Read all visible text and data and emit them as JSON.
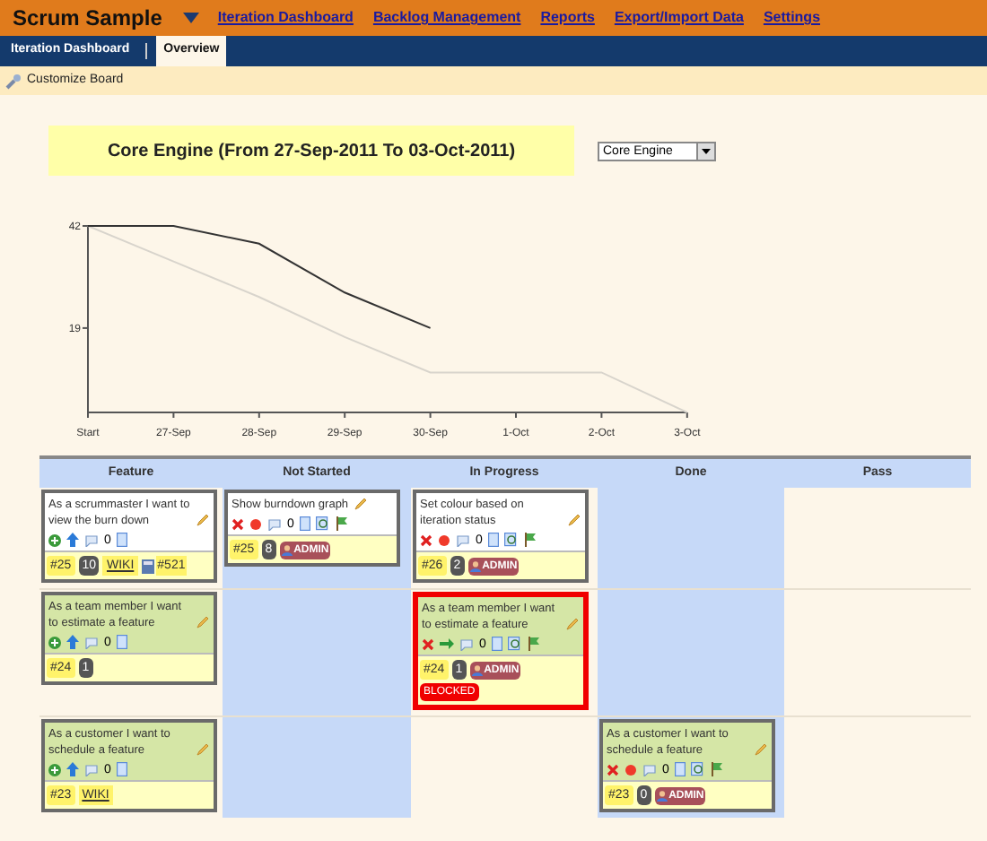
{
  "header": {
    "title": "Scrum Sample",
    "nav": [
      "Iteration Dashboard",
      "Backlog Management",
      "Reports",
      "Export/Import Data",
      "Settings"
    ]
  },
  "subnav": {
    "tabs": [
      {
        "label": "Iteration Dashboard",
        "selected": false
      },
      {
        "label": "Overview",
        "selected": true
      }
    ]
  },
  "toolbar": {
    "action": "Customize Board"
  },
  "iteration": {
    "title": "Core Engine (From 27-Sep-2011 To 03-Oct-2011)",
    "select_value": "Core Engine"
  },
  "burndown": {
    "chart_data": {
      "type": "line",
      "categories": [
        "Start",
        "27-Sep",
        "28-Sep",
        "29-Sep",
        "30-Sep",
        "1-Oct",
        "2-Oct",
        "3-Oct"
      ],
      "yticks": [
        19,
        42
      ],
      "ylim": [
        0,
        42
      ],
      "series": [
        {
          "color": "#333333",
          "values": [
            42,
            42,
            38,
            27,
            19,
            null,
            null,
            null
          ]
        },
        {
          "color": "#d8d4cc",
          "values": [
            42,
            34,
            26,
            17,
            9,
            9,
            9,
            0
          ]
        }
      ]
    }
  },
  "board": {
    "columns": [
      "Feature",
      "Not Started",
      "In Progress",
      "Done",
      "Pass"
    ],
    "rows": [
      {
        "feature": {
          "kind": "feature",
          "text": "As a scrummaster I want to view the burn down",
          "color": "#ffffff",
          "blocked": false,
          "comments": "0",
          "id": "#25",
          "estimate": "10",
          "wiki": "WIKI",
          "ref": "#521"
        },
        "not_started": {
          "kind": "task",
          "text": "Show burndown graph",
          "color": "#ffffff",
          "blocked": false,
          "started": false,
          "comments": "0",
          "id": "#25",
          "estimate": "8",
          "owner": "ADMIN"
        },
        "in_progress": {
          "kind": "task",
          "text": "Set colour based on iteration status",
          "color": "#ffffff",
          "blocked": false,
          "started": false,
          "comments": "0",
          "id": "#26",
          "estimate": "2",
          "owner": "ADMIN"
        }
      },
      {
        "feature": {
          "kind": "feature",
          "text": "As a team member I want to estimate a feature",
          "color": "#d5e6a6",
          "blocked": false,
          "comments": "0",
          "id": "#24",
          "estimate": "1"
        },
        "in_progress": {
          "kind": "task",
          "text": "As a team member I want to estimate a feature",
          "color": "#d5e6a6",
          "blocked": true,
          "started": true,
          "comments": "0",
          "id": "#24",
          "estimate": "1",
          "owner": "ADMIN",
          "flag": "BLOCKED"
        }
      },
      {
        "feature": {
          "kind": "feature",
          "text": "As a customer I want to schedule a feature",
          "color": "#d5e6a6",
          "blocked": false,
          "comments": "0",
          "id": "#23",
          "wiki": "WIKI"
        },
        "done": {
          "kind": "task",
          "text": "As a customer I want to schedule a feature",
          "color": "#d5e6a6",
          "blocked": false,
          "started": false,
          "comments": "0",
          "id": "#23",
          "estimate": "0",
          "owner": "ADMIN"
        }
      }
    ]
  }
}
